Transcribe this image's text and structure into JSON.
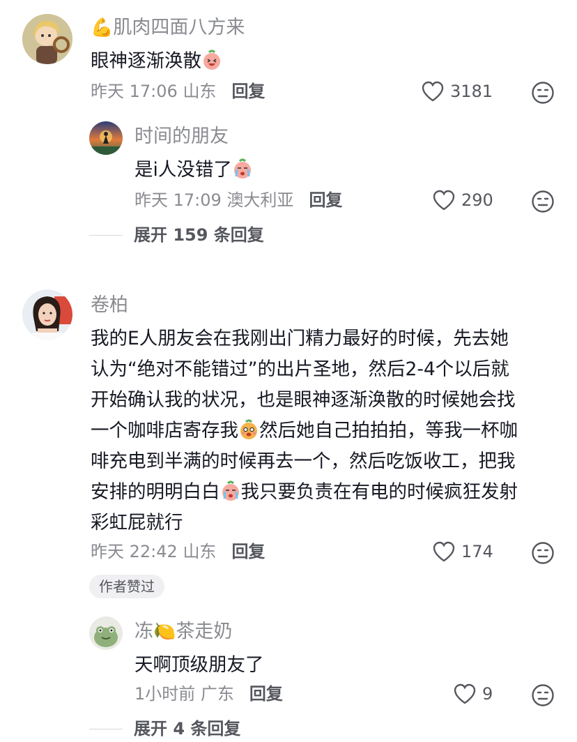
{
  "comments": [
    {
      "username_emoji": "💪",
      "username": "肌肉四面八方来",
      "text": "眼神逐渐涣散",
      "time": "昨天 17:06",
      "location": "山东",
      "reply_label": "回复",
      "likes": "3181",
      "replies": [
        {
          "username": "时间的朋友",
          "text": "是i人没错了",
          "time": "昨天 17:09",
          "location": "澳大利亚",
          "reply_label": "回复",
          "likes": "290"
        }
      ],
      "expand_label": "展开 159 条回复"
    },
    {
      "username": "卷柏",
      "text_lines": [
        "我的E人朋友会在我刚出门精力最好的时候，先去她",
        "认为“绝对不能错过”的出片圣地，然后2-4个以后就",
        "开始确认我的状况，也是眼神逐渐涣散的时候她会找",
        "一个咖啡店寄存我",
        "然后她自己拍拍拍，等我一杯咖",
        "啡充电到半满的时候再去一个，然后吃饭收工，把我",
        "安排的明明白白",
        "我只要负责在有电的时候疯狂发射",
        "彩虹屁就行"
      ],
      "time": "昨天 22:42",
      "location": "山东",
      "reply_label": "回复",
      "likes": "174",
      "author_badge": "作者赞过",
      "replies": [
        {
          "username_part1": "冻",
          "username_emoji": "🍋",
          "username_part2": "茶走奶",
          "text": "天啊顶级朋友了",
          "time": "1小时前",
          "location": "广东",
          "reply_label": "回复",
          "likes": "9"
        }
      ],
      "expand_label": "展开 4 条回复"
    }
  ]
}
